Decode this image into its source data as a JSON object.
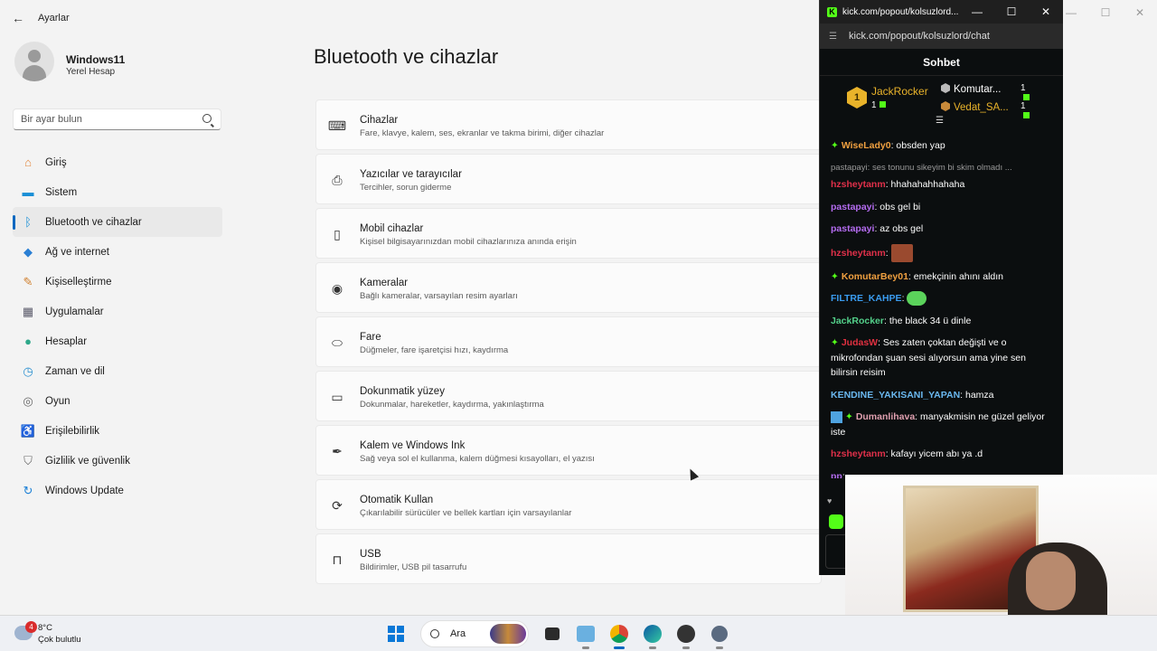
{
  "window": {
    "title": "Ayarlar",
    "controls": [
      "—",
      "☐",
      "✕"
    ]
  },
  "profile": {
    "name": "Windows11",
    "subtitle": "Yerel Hesap"
  },
  "search": {
    "placeholder": "Bir ayar bulun"
  },
  "nav": {
    "items": [
      {
        "label": "Giriş",
        "icon": "home-icon",
        "color": "#e2863b",
        "glyph": "⌂"
      },
      {
        "label": "Sistem",
        "icon": "system-icon",
        "color": "#1a8fd6",
        "glyph": "▬"
      },
      {
        "label": "Bluetooth ve cihazlar",
        "icon": "bluetooth-icon",
        "color": "#1a8fd6",
        "glyph": "ᛒ"
      },
      {
        "label": "Ağ ve internet",
        "icon": "network-icon",
        "color": "#2a7fd4",
        "glyph": "◆"
      },
      {
        "label": "Kişiselleştirme",
        "icon": "brush-icon",
        "color": "#d08030",
        "glyph": "✎"
      },
      {
        "label": "Uygulamalar",
        "icon": "apps-icon",
        "color": "#5a5a6a",
        "glyph": "▦"
      },
      {
        "label": "Hesaplar",
        "icon": "accounts-icon",
        "color": "#2ea88a",
        "glyph": "●"
      },
      {
        "label": "Zaman ve dil",
        "icon": "time-language-icon",
        "color": "#2a8fd0",
        "glyph": "◷"
      },
      {
        "label": "Oyun",
        "icon": "gaming-icon",
        "color": "#666666",
        "glyph": "◎"
      },
      {
        "label": "Erişilebilirlik",
        "icon": "accessibility-icon",
        "color": "#1a6fd0",
        "glyph": "♿"
      },
      {
        "label": "Gizlilik ve güvenlik",
        "icon": "shield-icon",
        "color": "#6a6a6a",
        "glyph": "⛉"
      },
      {
        "label": "Windows Update",
        "icon": "update-icon",
        "color": "#1a7fd6",
        "glyph": "↻"
      }
    ],
    "active_index": 2
  },
  "main": {
    "title": "Bluetooth ve cihazlar",
    "cards": [
      {
        "title": "Cihazlar",
        "subtitle": "Fare, klavye, kalem, ses, ekranlar ve takma birimi, diğer cihazlar",
        "icon": "devices-icon",
        "glyph": "⌨"
      },
      {
        "title": "Yazıcılar ve tarayıcılar",
        "subtitle": "Tercihler, sorun giderme",
        "icon": "printer-icon",
        "glyph": "⎙"
      },
      {
        "title": "Mobil cihazlar",
        "subtitle": "Kişisel bilgisayarınızdan mobil cihazlarınıza anında erişin",
        "icon": "phone-icon",
        "glyph": "▯"
      },
      {
        "title": "Kameralar",
        "subtitle": "Bağlı kameralar, varsayılan resim ayarları",
        "icon": "camera-icon",
        "glyph": "◉"
      },
      {
        "title": "Fare",
        "subtitle": "Düğmeler, fare işaretçisi hızı, kaydırma",
        "icon": "mouse-icon",
        "glyph": "⬭"
      },
      {
        "title": "Dokunmatik yüzey",
        "subtitle": "Dokunmalar, hareketler, kaydırma, yakınlaştırma",
        "icon": "touchpad-icon",
        "glyph": "▭"
      },
      {
        "title": "Kalem ve Windows Ink",
        "subtitle": "Sağ veya sol el kullanma, kalem düğmesi kısayolları, el yazısı",
        "icon": "pen-icon",
        "glyph": "✒"
      },
      {
        "title": "Otomatik Kullan",
        "subtitle": "Çıkarılabilir sürücüler ve bellek kartları için varsayılanlar",
        "icon": "autoplay-icon",
        "glyph": "⟳"
      },
      {
        "title": "USB",
        "subtitle": "Bildirimler, USB pil tasarrufu",
        "icon": "usb-icon",
        "glyph": "⊓"
      }
    ]
  },
  "chat": {
    "window_title": "kick.com/popout/kolsuzlord...",
    "url": "kick.com/popout/kolsuzlord/chat",
    "header": "Sohbet",
    "leaders": {
      "first": {
        "rank": "1",
        "name": "JackRocker",
        "count": "1"
      },
      "second": {
        "name": "Komutar...",
        "count": "1"
      },
      "third": {
        "name": "Vedat_SA...",
        "count": "1"
      }
    },
    "messages": [
      {
        "user": "WiseLady0",
        "color": "#f0a040",
        "text": "obsden yap",
        "star": true
      },
      {
        "reply": "pastapayi: ses tonunu sikeyim bi skim olmadı ..."
      },
      {
        "user": "hzsheytanm",
        "color": "#e0304a",
        "text": "hhahahahhahaha"
      },
      {
        "user": "pastapayi",
        "color": "#b46cf0",
        "text": "obs gel bi"
      },
      {
        "user": "pastapayi",
        "color": "#b46cf0",
        "text": "az obs gel"
      },
      {
        "user": "hzsheytanm",
        "color": "#e0304a",
        "text": "",
        "emote": "img"
      },
      {
        "user": "KomutarBey01",
        "color": "#f0a040",
        "text": "emekçinin ahını aldın",
        "star": true
      },
      {
        "user": "FILTRE_KAHPE",
        "color": "#3a9cf0",
        "text": "",
        "emote": "frog"
      },
      {
        "user": "JackRocker",
        "color": "#53d08a",
        "text": "the black 34 ü dinle"
      },
      {
        "user": "JudasW",
        "color": "#e03040",
        "text": "Ses zaten çoktan değişti ve o mikrofondan şuan sesi alıyorsun ama yine sen bilirsin reisim",
        "star": true
      },
      {
        "user": "KENDINE_YAKISANI_YAPAN",
        "color": "#6ab8f0",
        "text": "hamza"
      },
      {
        "user": "Dumanlihava",
        "color": "#e0a0b0",
        "text": "manyakmisin ne güzel geliyor iste",
        "star": true,
        "badge": true
      },
      {
        "user": "hzsheytanm",
        "color": "#e0304a",
        "text": "kafayı yicem abı ya .d"
      },
      {
        "user": "pp",
        "color": "#b46cf0",
        "text": "...",
        "partial": true
      }
    ]
  },
  "taskbar": {
    "weather": {
      "temp": "8°C",
      "condition": "Çok bulutlu",
      "badge": "4"
    },
    "search_label": "Ara"
  }
}
